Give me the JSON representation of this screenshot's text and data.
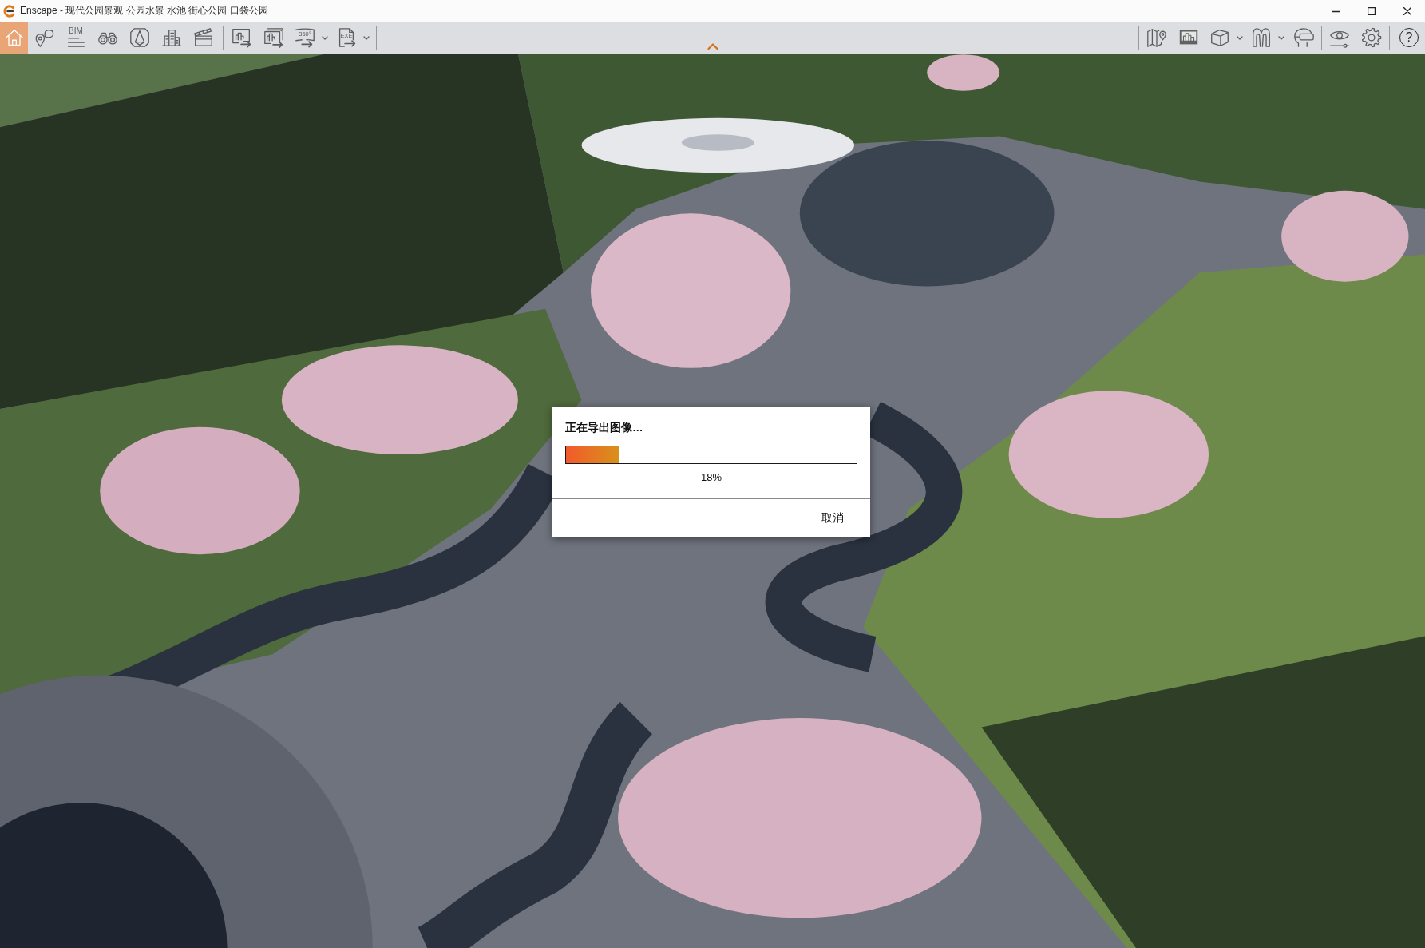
{
  "window": {
    "title": "Enscape - 现代公园景观 公园水景 水池 街心公园 口袋公园"
  },
  "toolbar": {
    "left_groups": [
      {
        "tools": [
          {
            "selected": true,
            "menu": false
          },
          {
            "selected": false,
            "menu": false
          },
          {
            "label": "BIM",
            "selected": false,
            "menu": false
          },
          {
            "selected": false,
            "menu": false
          },
          {
            "selected": false,
            "menu": false
          },
          {
            "selected": false,
            "menu": false
          },
          {
            "selected": false,
            "menu": false
          }
        ]
      },
      {
        "tools": [
          {
            "selected": false,
            "menu": false
          },
          {
            "selected": false,
            "menu": false
          },
          {
            "label": "360°",
            "selected": false,
            "menu": true
          },
          {
            "label": "EXE",
            "selected": false,
            "menu": true
          }
        ]
      }
    ],
    "right_groups": [
      {
        "tools": [
          {
            "selected": false,
            "menu": false
          },
          {
            "selected": false,
            "menu": false
          },
          {
            "selected": false,
            "menu": true
          },
          {
            "selected": false,
            "menu": true
          },
          {
            "selected": false,
            "menu": false
          }
        ]
      },
      {
        "tools": [
          {
            "selected": false,
            "menu": false
          },
          {
            "selected": false,
            "menu": false
          }
        ]
      },
      {
        "tools": [
          {
            "label": "?",
            "selected": false
          }
        ]
      }
    ]
  },
  "dialog": {
    "title": "正在导出图像…",
    "progress": {
      "level": 0.18,
      "reading": "18%"
    },
    "buttons": [
      "取消"
    ]
  }
}
